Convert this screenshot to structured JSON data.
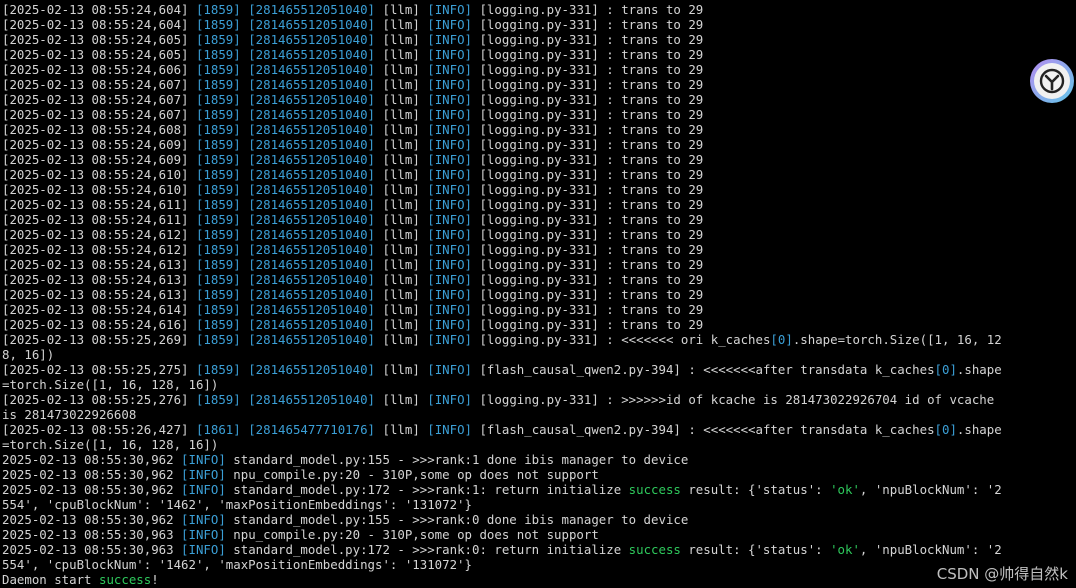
{
  "watermark": "CSDN @帅得自然k",
  "assistant_icon": "assistant-logo-icon",
  "colors": {
    "background": "#000000",
    "text": "#d4d4d4",
    "cyan": "#3b9fd6",
    "green": "#2ec95c"
  },
  "lines": [
    [
      {
        "t": "[2025-02-13 08:55:24,604] "
      },
      {
        "t": "[1859]",
        "c": "cy"
      },
      {
        "t": " "
      },
      {
        "t": "[281465512051040]",
        "c": "cy"
      },
      {
        "t": " [llm] "
      },
      {
        "t": "[INFO]",
        "c": "cy"
      },
      {
        "t": " [logging.py-331] : trans to 29"
      }
    ],
    [
      {
        "t": "[2025-02-13 08:55:24,604] "
      },
      {
        "t": "[1859]",
        "c": "cy"
      },
      {
        "t": " "
      },
      {
        "t": "[281465512051040]",
        "c": "cy"
      },
      {
        "t": " [llm] "
      },
      {
        "t": "[INFO]",
        "c": "cy"
      },
      {
        "t": " [logging.py-331] : trans to 29"
      }
    ],
    [
      {
        "t": "[2025-02-13 08:55:24,605] "
      },
      {
        "t": "[1859]",
        "c": "cy"
      },
      {
        "t": " "
      },
      {
        "t": "[281465512051040]",
        "c": "cy"
      },
      {
        "t": " [llm] "
      },
      {
        "t": "[INFO]",
        "c": "cy"
      },
      {
        "t": " [logging.py-331] : trans to 29"
      }
    ],
    [
      {
        "t": "[2025-02-13 08:55:24,605] "
      },
      {
        "t": "[1859]",
        "c": "cy"
      },
      {
        "t": " "
      },
      {
        "t": "[281465512051040]",
        "c": "cy"
      },
      {
        "t": " [llm] "
      },
      {
        "t": "[INFO]",
        "c": "cy"
      },
      {
        "t": " [logging.py-331] : trans to 29"
      }
    ],
    [
      {
        "t": "[2025-02-13 08:55:24,606] "
      },
      {
        "t": "[1859]",
        "c": "cy"
      },
      {
        "t": " "
      },
      {
        "t": "[281465512051040]",
        "c": "cy"
      },
      {
        "t": " [llm] "
      },
      {
        "t": "[INFO]",
        "c": "cy"
      },
      {
        "t": " [logging.py-331] : trans to 29"
      }
    ],
    [
      {
        "t": "[2025-02-13 08:55:24,607] "
      },
      {
        "t": "[1859]",
        "c": "cy"
      },
      {
        "t": " "
      },
      {
        "t": "[281465512051040]",
        "c": "cy"
      },
      {
        "t": " [llm] "
      },
      {
        "t": "[INFO]",
        "c": "cy"
      },
      {
        "t": " [logging.py-331] : trans to 29"
      }
    ],
    [
      {
        "t": "[2025-02-13 08:55:24,607] "
      },
      {
        "t": "[1859]",
        "c": "cy"
      },
      {
        "t": " "
      },
      {
        "t": "[281465512051040]",
        "c": "cy"
      },
      {
        "t": " [llm] "
      },
      {
        "t": "[INFO]",
        "c": "cy"
      },
      {
        "t": " [logging.py-331] : trans to 29"
      }
    ],
    [
      {
        "t": "[2025-02-13 08:55:24,607] "
      },
      {
        "t": "[1859]",
        "c": "cy"
      },
      {
        "t": " "
      },
      {
        "t": "[281465512051040]",
        "c": "cy"
      },
      {
        "t": " [llm] "
      },
      {
        "t": "[INFO]",
        "c": "cy"
      },
      {
        "t": " [logging.py-331] : trans to 29"
      }
    ],
    [
      {
        "t": "[2025-02-13 08:55:24,608] "
      },
      {
        "t": "[1859]",
        "c": "cy"
      },
      {
        "t": " "
      },
      {
        "t": "[281465512051040]",
        "c": "cy"
      },
      {
        "t": " [llm] "
      },
      {
        "t": "[INFO]",
        "c": "cy"
      },
      {
        "t": " [logging.py-331] : trans to 29"
      }
    ],
    [
      {
        "t": "[2025-02-13 08:55:24,609] "
      },
      {
        "t": "[1859]",
        "c": "cy"
      },
      {
        "t": " "
      },
      {
        "t": "[281465512051040]",
        "c": "cy"
      },
      {
        "t": " [llm] "
      },
      {
        "t": "[INFO]",
        "c": "cy"
      },
      {
        "t": " [logging.py-331] : trans to 29"
      }
    ],
    [
      {
        "t": "[2025-02-13 08:55:24,609] "
      },
      {
        "t": "[1859]",
        "c": "cy"
      },
      {
        "t": " "
      },
      {
        "t": "[281465512051040]",
        "c": "cy"
      },
      {
        "t": " [llm] "
      },
      {
        "t": "[INFO]",
        "c": "cy"
      },
      {
        "t": " [logging.py-331] : trans to 29"
      }
    ],
    [
      {
        "t": "[2025-02-13 08:55:24,610] "
      },
      {
        "t": "[1859]",
        "c": "cy"
      },
      {
        "t": " "
      },
      {
        "t": "[281465512051040]",
        "c": "cy"
      },
      {
        "t": " [llm] "
      },
      {
        "t": "[INFO]",
        "c": "cy"
      },
      {
        "t": " [logging.py-331] : trans to 29"
      }
    ],
    [
      {
        "t": "[2025-02-13 08:55:24,610] "
      },
      {
        "t": "[1859]",
        "c": "cy"
      },
      {
        "t": " "
      },
      {
        "t": "[281465512051040]",
        "c": "cy"
      },
      {
        "t": " [llm] "
      },
      {
        "t": "[INFO]",
        "c": "cy"
      },
      {
        "t": " [logging.py-331] : trans to 29"
      }
    ],
    [
      {
        "t": "[2025-02-13 08:55:24,611] "
      },
      {
        "t": "[1859]",
        "c": "cy"
      },
      {
        "t": " "
      },
      {
        "t": "[281465512051040]",
        "c": "cy"
      },
      {
        "t": " [llm] "
      },
      {
        "t": "[INFO]",
        "c": "cy"
      },
      {
        "t": " [logging.py-331] : trans to 29"
      }
    ],
    [
      {
        "t": "[2025-02-13 08:55:24,611] "
      },
      {
        "t": "[1859]",
        "c": "cy"
      },
      {
        "t": " "
      },
      {
        "t": "[281465512051040]",
        "c": "cy"
      },
      {
        "t": " [llm] "
      },
      {
        "t": "[INFO]",
        "c": "cy"
      },
      {
        "t": " [logging.py-331] : trans to 29"
      }
    ],
    [
      {
        "t": "[2025-02-13 08:55:24,612] "
      },
      {
        "t": "[1859]",
        "c": "cy"
      },
      {
        "t": " "
      },
      {
        "t": "[281465512051040]",
        "c": "cy"
      },
      {
        "t": " [llm] "
      },
      {
        "t": "[INFO]",
        "c": "cy"
      },
      {
        "t": " [logging.py-331] : trans to 29"
      }
    ],
    [
      {
        "t": "[2025-02-13 08:55:24,612] "
      },
      {
        "t": "[1859]",
        "c": "cy"
      },
      {
        "t": " "
      },
      {
        "t": "[281465512051040]",
        "c": "cy"
      },
      {
        "t": " [llm] "
      },
      {
        "t": "[INFO]",
        "c": "cy"
      },
      {
        "t": " [logging.py-331] : trans to 29"
      }
    ],
    [
      {
        "t": "[2025-02-13 08:55:24,613] "
      },
      {
        "t": "[1859]",
        "c": "cy"
      },
      {
        "t": " "
      },
      {
        "t": "[281465512051040]",
        "c": "cy"
      },
      {
        "t": " [llm] "
      },
      {
        "t": "[INFO]",
        "c": "cy"
      },
      {
        "t": " [logging.py-331] : trans to 29"
      }
    ],
    [
      {
        "t": "[2025-02-13 08:55:24,613] "
      },
      {
        "t": "[1859]",
        "c": "cy"
      },
      {
        "t": " "
      },
      {
        "t": "[281465512051040]",
        "c": "cy"
      },
      {
        "t": " [llm] "
      },
      {
        "t": "[INFO]",
        "c": "cy"
      },
      {
        "t": " [logging.py-331] : trans to 29"
      }
    ],
    [
      {
        "t": "[2025-02-13 08:55:24,613] "
      },
      {
        "t": "[1859]",
        "c": "cy"
      },
      {
        "t": " "
      },
      {
        "t": "[281465512051040]",
        "c": "cy"
      },
      {
        "t": " [llm] "
      },
      {
        "t": "[INFO]",
        "c": "cy"
      },
      {
        "t": " [logging.py-331] : trans to 29"
      }
    ],
    [
      {
        "t": "[2025-02-13 08:55:24,614] "
      },
      {
        "t": "[1859]",
        "c": "cy"
      },
      {
        "t": " "
      },
      {
        "t": "[281465512051040]",
        "c": "cy"
      },
      {
        "t": " [llm] "
      },
      {
        "t": "[INFO]",
        "c": "cy"
      },
      {
        "t": " [logging.py-331] : trans to 29"
      }
    ],
    [
      {
        "t": "[2025-02-13 08:55:24,616] "
      },
      {
        "t": "[1859]",
        "c": "cy"
      },
      {
        "t": " "
      },
      {
        "t": "[281465512051040]",
        "c": "cy"
      },
      {
        "t": " [llm] "
      },
      {
        "t": "[INFO]",
        "c": "cy"
      },
      {
        "t": " [logging.py-331] : trans to 29"
      }
    ],
    [
      {
        "t": "[2025-02-13 08:55:25,269] "
      },
      {
        "t": "[1859]",
        "c": "cy"
      },
      {
        "t": " "
      },
      {
        "t": "[281465512051040]",
        "c": "cy"
      },
      {
        "t": " [llm] "
      },
      {
        "t": "[INFO]",
        "c": "cy"
      },
      {
        "t": " [logging.py-331] : <<<<<<< ori k_caches"
      },
      {
        "t": "[0]",
        "c": "cy"
      },
      {
        "t": ".shape=torch.Size([1, 16, 12"
      }
    ],
    [
      {
        "t": "8, 16])"
      }
    ],
    [
      {
        "t": "[2025-02-13 08:55:25,275] "
      },
      {
        "t": "[1859]",
        "c": "cy"
      },
      {
        "t": " "
      },
      {
        "t": "[281465512051040]",
        "c": "cy"
      },
      {
        "t": " [llm] "
      },
      {
        "t": "[INFO]",
        "c": "cy"
      },
      {
        "t": " [flash_causal_qwen2.py-394] : <<<<<<<after transdata k_caches"
      },
      {
        "t": "[0]",
        "c": "cy"
      },
      {
        "t": ".shape"
      }
    ],
    [
      {
        "t": "=torch.Size([1, 16, 128, 16])"
      }
    ],
    [
      {
        "t": "[2025-02-13 08:55:25,276] "
      },
      {
        "t": "[1859]",
        "c": "cy"
      },
      {
        "t": " "
      },
      {
        "t": "[281465512051040]",
        "c": "cy"
      },
      {
        "t": " [llm] "
      },
      {
        "t": "[INFO]",
        "c": "cy"
      },
      {
        "t": " [logging.py-331] : >>>>>>id of kcache is 281473022926704 id of vcache"
      }
    ],
    [
      {
        "t": "is 281473022926608"
      }
    ],
    [
      {
        "t": "[2025-02-13 08:55:26,427] "
      },
      {
        "t": "[1861]",
        "c": "cy"
      },
      {
        "t": " "
      },
      {
        "t": "[281465477710176]",
        "c": "cy"
      },
      {
        "t": " [llm] "
      },
      {
        "t": "[INFO]",
        "c": "cy"
      },
      {
        "t": " [flash_causal_qwen2.py-394] : <<<<<<<after transdata k_caches"
      },
      {
        "t": "[0]",
        "c": "cy"
      },
      {
        "t": ".shape"
      }
    ],
    [
      {
        "t": "=torch.Size([1, 16, 128, 16])"
      }
    ],
    [
      {
        "t": "2025-02-13 08:55:30,962 "
      },
      {
        "t": "[INFO]",
        "c": "cy"
      },
      {
        "t": " standard_model.py:155 - >>>rank:1 done ibis manager to device"
      }
    ],
    [
      {
        "t": "2025-02-13 08:55:30,962 "
      },
      {
        "t": "[INFO]",
        "c": "cy"
      },
      {
        "t": " npu_compile.py:20 - 310P,some op does not support"
      }
    ],
    [
      {
        "t": "2025-02-13 08:55:30,962 "
      },
      {
        "t": "[INFO]",
        "c": "cy"
      },
      {
        "t": " standard_model.py:172 - >>>rank:1: return initialize "
      },
      {
        "t": "success",
        "c": "gr"
      },
      {
        "t": " result: {'status': "
      },
      {
        "t": "'ok'",
        "c": "gr"
      },
      {
        "t": ", 'npuBlockNum': '2"
      }
    ],
    [
      {
        "t": "554', 'cpuBlockNum': '1462', 'maxPositionEmbeddings': '131072'}"
      }
    ],
    [
      {
        "t": "2025-02-13 08:55:30,962 "
      },
      {
        "t": "[INFO]",
        "c": "cy"
      },
      {
        "t": " standard_model.py:155 - >>>rank:0 done ibis manager to device"
      }
    ],
    [
      {
        "t": "2025-02-13 08:55:30,963 "
      },
      {
        "t": "[INFO]",
        "c": "cy"
      },
      {
        "t": " npu_compile.py:20 - 310P,some op does not support"
      }
    ],
    [
      {
        "t": "2025-02-13 08:55:30,963 "
      },
      {
        "t": "[INFO]",
        "c": "cy"
      },
      {
        "t": " standard_model.py:172 - >>>rank:0: return initialize "
      },
      {
        "t": "success",
        "c": "gr"
      },
      {
        "t": " result: {'status': "
      },
      {
        "t": "'ok'",
        "c": "gr"
      },
      {
        "t": ", 'npuBlockNum': '2"
      }
    ],
    [
      {
        "t": "554', 'cpuBlockNum': '1462', 'maxPositionEmbeddings': '131072'}"
      }
    ],
    [
      {
        "t": "Daemon start "
      },
      {
        "t": "success",
        "c": "gr"
      },
      {
        "t": "!"
      }
    ]
  ]
}
